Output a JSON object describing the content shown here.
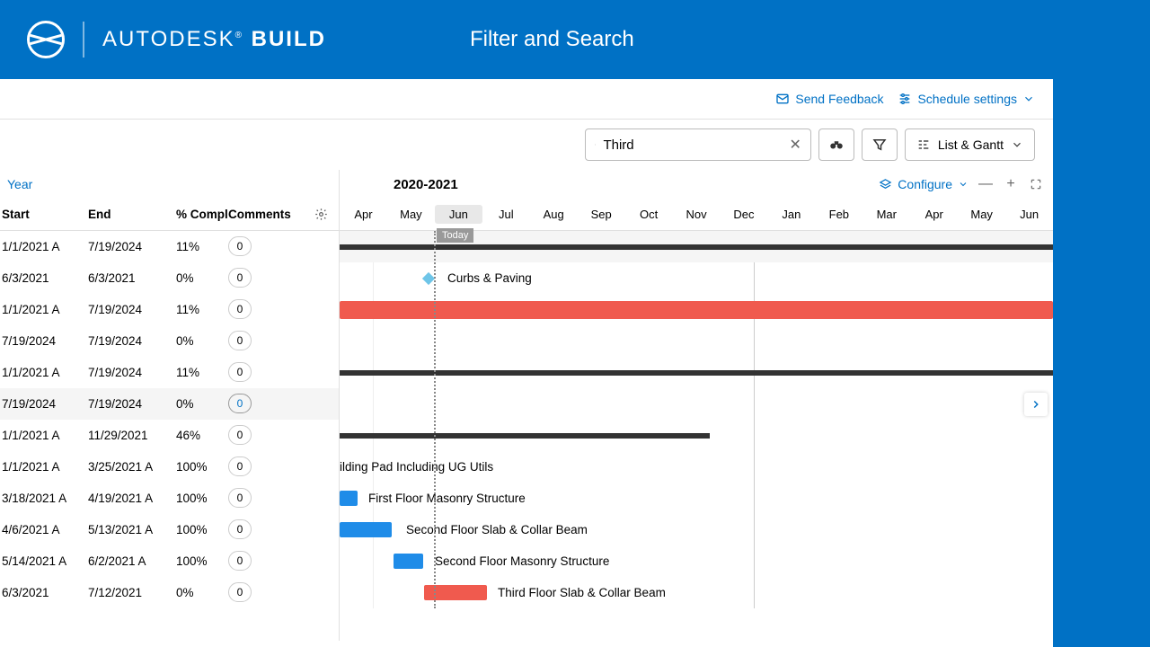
{
  "header": {
    "brand_prefix": "AUTODESK",
    "brand_suffix": "BUILD",
    "page_title": "Filter and Search"
  },
  "actions": {
    "feedback": "Send Feedback",
    "settings": "Schedule settings"
  },
  "toolbar": {
    "search_value": "Third",
    "view_label": "List & Gantt"
  },
  "left": {
    "year_label": "Year",
    "cols": {
      "start": "Start",
      "end": "End",
      "compl": "% Compl",
      "comments": "Comments"
    }
  },
  "timeline": {
    "title": "2020-2021",
    "configure": "Configure",
    "today": "Today",
    "months": [
      "Apr",
      "May",
      "Jun",
      "Jul",
      "Aug",
      "Sep",
      "Oct",
      "Nov",
      "Dec",
      "Jan",
      "Feb",
      "Mar",
      "Apr",
      "May",
      "Jun"
    ]
  },
  "rows": [
    {
      "start": "1/1/2021 A",
      "end": "7/19/2024",
      "compl": "11%",
      "c": "0"
    },
    {
      "start": "6/3/2021",
      "end": "6/3/2021",
      "compl": "0%",
      "c": "0"
    },
    {
      "start": "1/1/2021 A",
      "end": "7/19/2024",
      "compl": "11%",
      "c": "0"
    },
    {
      "start": "7/19/2024",
      "end": "7/19/2024",
      "compl": "0%",
      "c": "0"
    },
    {
      "start": "1/1/2021 A",
      "end": "7/19/2024",
      "compl": "11%",
      "c": "0"
    },
    {
      "start": "7/19/2024",
      "end": "7/19/2024",
      "compl": "0%",
      "c": "0"
    },
    {
      "start": "1/1/2021 A",
      "end": "11/29/2021",
      "compl": "46%",
      "c": "0"
    },
    {
      "start": "1/1/2021 A",
      "end": "3/25/2021 A",
      "compl": "100%",
      "c": "0"
    },
    {
      "start": "3/18/2021 A",
      "end": "4/19/2021 A",
      "compl": "100%",
      "c": "0"
    },
    {
      "start": "4/6/2021 A",
      "end": "5/13/2021 A",
      "compl": "100%",
      "c": "0"
    },
    {
      "start": "5/14/2021 A",
      "end": "6/2/2021 A",
      "compl": "100%",
      "c": "0"
    },
    {
      "start": "6/3/2021",
      "end": "7/12/2021",
      "compl": "0%",
      "c": "0"
    }
  ],
  "tasks": {
    "curbs": "Curbs & Paving",
    "pad": "ilding Pad Including UG Utils",
    "first_masonry": "First Floor Masonry Structure",
    "second_slab": "Second Floor Slab & Collar Beam",
    "second_masonry": "Second Floor Masonry Structure",
    "third_slab": "Third Floor Slab & Collar Beam"
  }
}
